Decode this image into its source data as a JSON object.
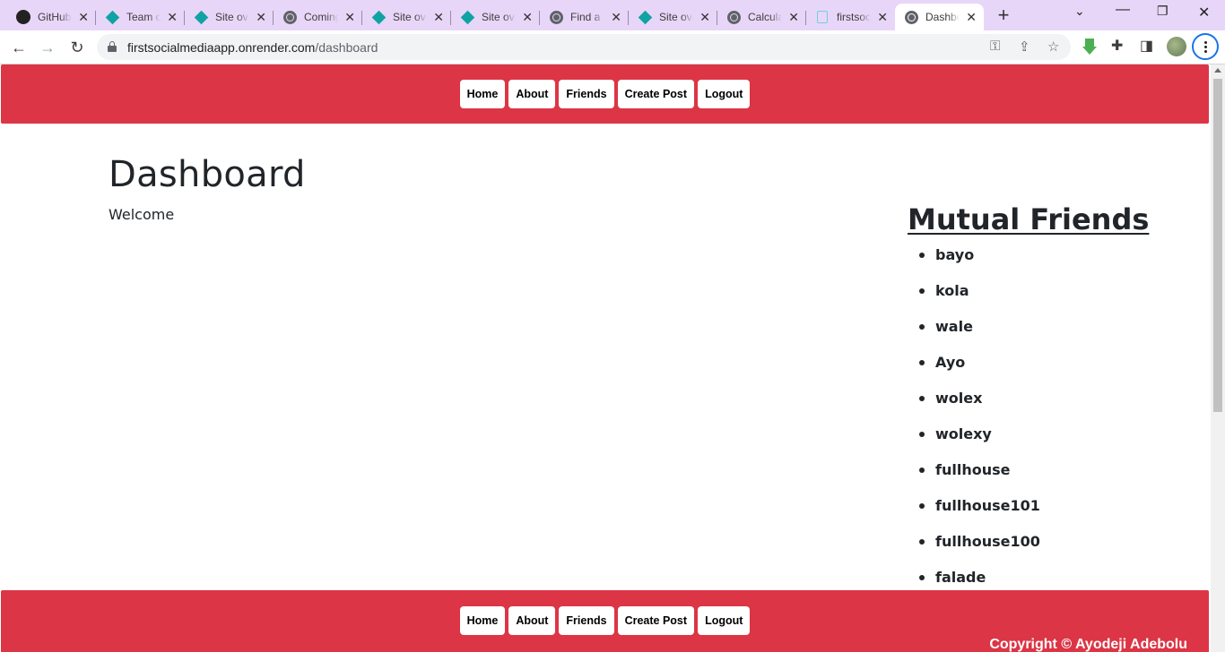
{
  "browser": {
    "tabs": [
      {
        "title": "GitHub",
        "icon": "github-icon"
      },
      {
        "title": "Team overview",
        "icon": "diamond-icon"
      },
      {
        "title": "Site overview",
        "icon": "diamond-icon"
      },
      {
        "title": "Coming soon",
        "icon": "globe-icon"
      },
      {
        "title": "Site overview",
        "icon": "diamond-icon"
      },
      {
        "title": "Site overview",
        "icon": "diamond-icon"
      },
      {
        "title": "Find a",
        "icon": "globe-icon"
      },
      {
        "title": "Site overview",
        "icon": "diamond-icon"
      },
      {
        "title": "Calculator",
        "icon": "globe-icon"
      },
      {
        "title": "firstsocialmediaapp",
        "icon": "document-icon"
      },
      {
        "title": "Dashboard",
        "icon": "globe-icon",
        "active": true
      }
    ],
    "url_host": "firstsocialmediaapp.onrender.com",
    "url_path": "/dashboard"
  },
  "nav": {
    "home": "Home",
    "about": "About",
    "friends": "Friends",
    "create_post": "Create Post",
    "logout": "Logout"
  },
  "main": {
    "title": "Dashboard",
    "welcome": "Welcome"
  },
  "mutual_friends": {
    "title": "Mutual Friends",
    "items": [
      "bayo",
      "kola",
      "wale",
      "Ayo",
      "wolex",
      "wolexy",
      "fullhouse",
      "fullhouse101",
      "fullhouse100",
      "falade"
    ]
  },
  "footer": {
    "copyright": "Copyright © Ayodeji Adebolu"
  },
  "colors": {
    "navbar": "#dc3545",
    "tabbar": "#e8d6f8"
  }
}
